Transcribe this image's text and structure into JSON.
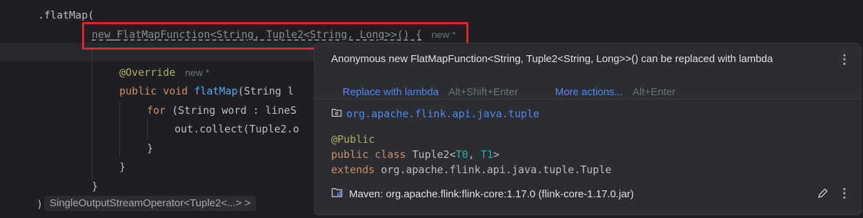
{
  "editor": {
    "line_flatmap": ".flatMap(",
    "decl_kw": "new",
    "decl_type": "FlatMapFunction<String, Tuple2<String, Long>>() {",
    "decl_hint": "new *",
    "override": "@Override",
    "override_hint": "new *",
    "public_kw": "public",
    "void_kw": "void",
    "method_name": "flatMap",
    "method_params": "(String l",
    "for_kw": "for",
    "for_rest": " (String word : lineS",
    "collect_line": "out.collect(Tuple2.o",
    "brace_close": "}",
    "paren_close": ")",
    "inlay_type": "SingleOutputStreamOperator<Tuple2<...> >"
  },
  "popup": {
    "message": "Anonymous new FlatMapFunction<String, Tuple2<String, Long>>() can be replaced with lambda",
    "replace_label": "Replace with lambda",
    "replace_shortcut": "Alt+Shift+Enter",
    "more_label": "More actions...",
    "more_shortcut": "Alt+Enter",
    "package": "org.apache.flink.api.java.tuple",
    "annotation": "@Public",
    "class_kw": "public class",
    "class_name": "Tuple2<",
    "t0": "T0",
    "comma": ", ",
    "t1": "T1",
    "class_end": ">",
    "extends_kw": "extends",
    "extends_target": "org.apache.flink.api.java.tuple.Tuple",
    "maven": "Maven: org.apache.flink:flink-core:1.17.0 (flink-core-1.17.0.jar)"
  },
  "icons": {
    "menu": "more-vertical-icon",
    "package": "package-folder-icon",
    "maven": "maven-library-icon",
    "edit": "pencil-icon"
  },
  "colors": {
    "highlight_box": "#e3242b",
    "link": "#548af7",
    "keyword": "#cf8e6d"
  }
}
